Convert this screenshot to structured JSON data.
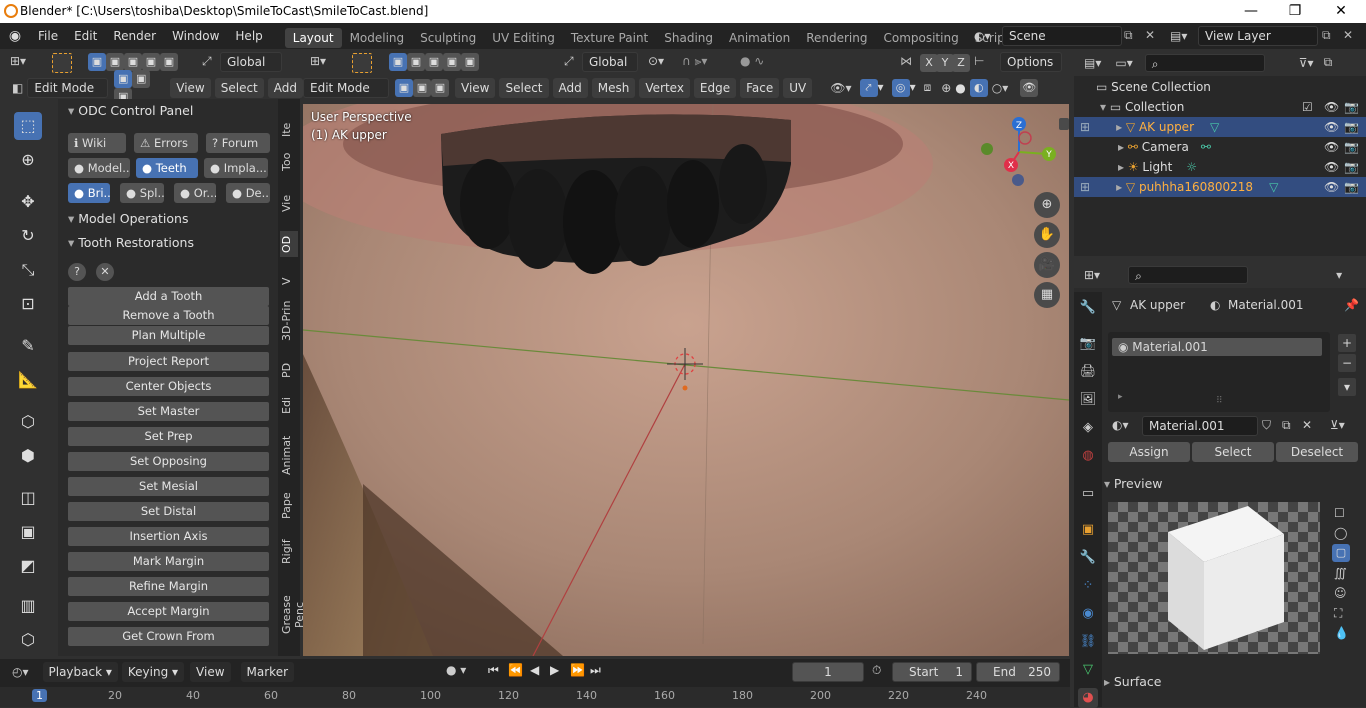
{
  "window": {
    "title": "Blender* [C:\\Users\\toshiba\\Desktop\\SmileToCast\\SmileToCast.blend]",
    "minimize": "—",
    "maximize": "❐",
    "close": "✕"
  },
  "menu": [
    "File",
    "Edit",
    "Render",
    "Window",
    "Help"
  ],
  "workspaces": [
    "Layout",
    "Modeling",
    "Sculpting",
    "UV Editing",
    "Texture Paint",
    "Shading",
    "Animation",
    "Rendering",
    "Compositing",
    "Scripting"
  ],
  "scene": {
    "name": "Scene",
    "view_layer": "View Layer"
  },
  "toolheader": {
    "mode": "Edit Mode",
    "orientation": "Global",
    "view": "View",
    "select": "Select",
    "add": "Add",
    "orientation2": "Global",
    "xyz": [
      "X",
      "Y",
      "Z"
    ],
    "options": "Options"
  },
  "viewport_header": {
    "mode": "Edit Mode",
    "items": [
      "View",
      "Select",
      "Add",
      "Mesh",
      "Vertex",
      "Edge",
      "Face",
      "UV"
    ]
  },
  "viewport": {
    "perspective": "User Perspective",
    "object": "(1) AK upper",
    "gizmo": {
      "x": "X",
      "y": "Y",
      "z": "Z"
    }
  },
  "odc": {
    "title": "ODC Control Panel",
    "links": [
      "Wiki",
      "Errors",
      "Forum"
    ],
    "row1": [
      "Model...",
      "Teeth",
      "Impla..."
    ],
    "row2": [
      "Bri...",
      "Spl...",
      "Or...",
      "De..."
    ],
    "model_ops": "Model Operations",
    "tooth_rest": "Tooth Restorations",
    "buttons": [
      "Add a Tooth",
      "Remove a Tooth",
      "Plan Multiple",
      "Project Report",
      "Center Objects",
      "Set Master",
      "Set Prep",
      "Set Opposing",
      "Set Mesial",
      "Set Distal",
      "Insertion Axis",
      "Mark Margin",
      "Refine Margin",
      "Accept Margin",
      "Get Crown From"
    ]
  },
  "vtabs": [
    "Ite",
    "Too",
    "Vie",
    "OD",
    "V",
    "3D-Prin",
    "PD",
    "Edi",
    "Animat",
    "Pape",
    "Rigif",
    "Grease Penc"
  ],
  "outliner": {
    "root": "Scene Collection",
    "collection": "Collection",
    "items": [
      "AK upper",
      "Camera",
      "Light",
      "puhhha160800218"
    ]
  },
  "properties": {
    "object": "AK upper",
    "material": "Material.001",
    "slot": "Material.001",
    "assign": "Assign",
    "select": "Select",
    "deselect": "Deselect",
    "preview": "Preview",
    "surface": "Surface"
  },
  "timeline": {
    "menus": [
      "Playback",
      "Keying",
      "View",
      "Marker"
    ],
    "frame": "1",
    "start_label": "Start",
    "start": "1",
    "end_label": "End",
    "end": "250",
    "ruler": [
      "1",
      "20",
      "40",
      "60",
      "80",
      "100",
      "120",
      "140",
      "160",
      "180",
      "200",
      "220",
      "240"
    ]
  }
}
